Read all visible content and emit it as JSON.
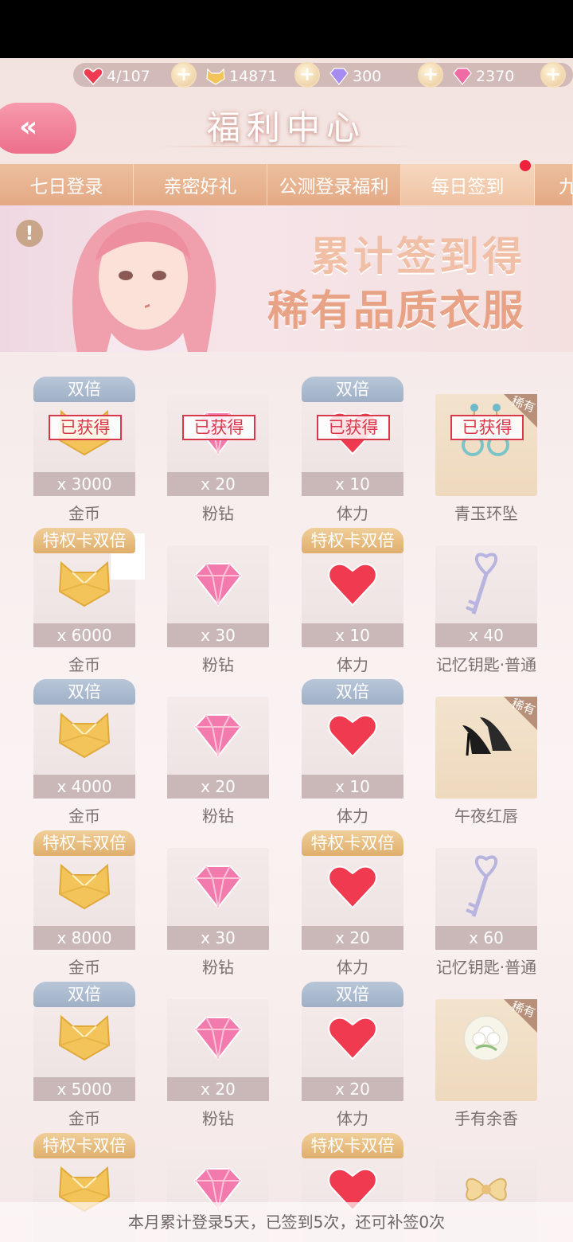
{
  "resources": {
    "stamina": "4/107",
    "coins": "14871",
    "diamonds": "300",
    "pink_diamonds": "2370"
  },
  "header": {
    "title": "福利中心"
  },
  "tabs": [
    "七日登录",
    "亲密好礼",
    "公测登录福利",
    "每日签到",
    "九"
  ],
  "banner": {
    "line1": "累计签到得",
    "line2": "稀有品质衣服"
  },
  "tags": {
    "double": "双倍",
    "priv": "特权卡双倍",
    "obtained": "已获得",
    "rare": "稀有"
  },
  "items": [
    {
      "name": "金币",
      "qty": "x 3000",
      "tag": "double",
      "icon": "coin",
      "obtained": true
    },
    {
      "name": "粉钻",
      "qty": "x 20",
      "tag": "",
      "icon": "diamond",
      "obtained": true
    },
    {
      "name": "体力",
      "qty": "x 10",
      "tag": "double",
      "icon": "heart",
      "obtained": true
    },
    {
      "name": "青玉环坠",
      "qty": "",
      "tag": "",
      "icon": "earring",
      "obtained": true,
      "rare": true
    },
    {
      "name": "金币",
      "qty": "x 6000",
      "tag": "priv",
      "icon": "coin"
    },
    {
      "name": "粉钻",
      "qty": "x 30",
      "tag": "",
      "icon": "diamond"
    },
    {
      "name": "体力",
      "qty": "x 10",
      "tag": "priv",
      "icon": "heart"
    },
    {
      "name": "记忆钥匙·普通",
      "qty": "x 40",
      "tag": "",
      "icon": "key"
    },
    {
      "name": "金币",
      "qty": "x 4000",
      "tag": "double",
      "icon": "coin"
    },
    {
      "name": "粉钻",
      "qty": "x 20",
      "tag": "",
      "icon": "diamond"
    },
    {
      "name": "体力",
      "qty": "x 10",
      "tag": "double",
      "icon": "heart"
    },
    {
      "name": "午夜红唇",
      "qty": "",
      "tag": "",
      "icon": "shoes",
      "rare": true
    },
    {
      "name": "金币",
      "qty": "x 8000",
      "tag": "priv",
      "icon": "coin"
    },
    {
      "name": "粉钻",
      "qty": "x 30",
      "tag": "",
      "icon": "diamond"
    },
    {
      "name": "体力",
      "qty": "x 20",
      "tag": "priv",
      "icon": "heart"
    },
    {
      "name": "记忆钥匙·普通",
      "qty": "x 60",
      "tag": "",
      "icon": "key"
    },
    {
      "name": "金币",
      "qty": "x 5000",
      "tag": "double",
      "icon": "coin"
    },
    {
      "name": "粉钻",
      "qty": "x 20",
      "tag": "",
      "icon": "diamond"
    },
    {
      "name": "体力",
      "qty": "x 20",
      "tag": "double",
      "icon": "heart"
    },
    {
      "name": "手有余香",
      "qty": "",
      "tag": "",
      "icon": "flower",
      "rare": true
    },
    {
      "name": "",
      "qty": "",
      "tag": "priv",
      "icon": "coin"
    },
    {
      "name": "",
      "qty": "",
      "tag": "",
      "icon": "diamond"
    },
    {
      "name": "",
      "qty": "",
      "tag": "priv",
      "icon": "heart"
    },
    {
      "name": "",
      "qty": "",
      "tag": "",
      "icon": "bow"
    }
  ],
  "footer": "本月累计登录5天，已签到5次，还可补签0次"
}
